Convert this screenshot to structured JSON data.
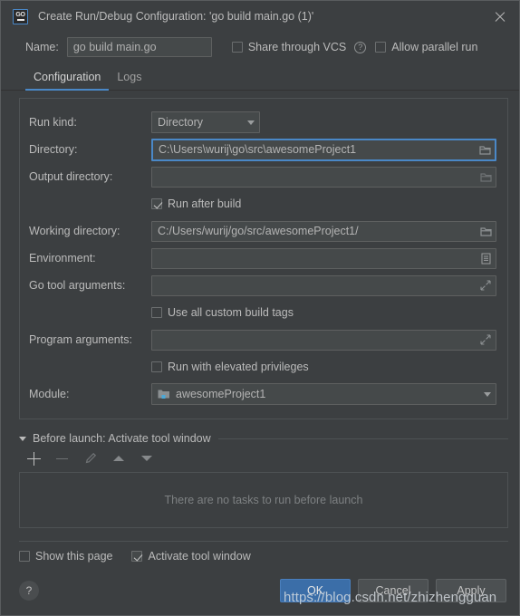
{
  "window": {
    "title": "Create Run/Debug Configuration: 'go build main.go (1)'",
    "app_icon": "go-icon",
    "close_icon": "close-icon"
  },
  "name_row": {
    "label": "Name:",
    "value": "go build main.go",
    "placeholder": "",
    "share_vcs_label": "Share through VCS",
    "share_vcs_checked": false,
    "help_icon": "help-icon",
    "allow_parallel_label": "Allow parallel run",
    "allow_parallel_checked": false
  },
  "tabs": [
    {
      "label": "Configuration",
      "active": true
    },
    {
      "label": "Logs",
      "active": false
    }
  ],
  "form": {
    "run_kind": {
      "label": "Run kind:",
      "value": "Directory"
    },
    "directory": {
      "label": "Directory:",
      "value": "C:\\Users\\wurij\\go\\src\\awesomeProject1",
      "icon": "folder-icon",
      "focused": true
    },
    "output_directory": {
      "label": "Output directory:",
      "value": "",
      "icon": "folder-icon"
    },
    "run_after_build": {
      "label": "Run after build",
      "checked": true
    },
    "working_directory": {
      "label": "Working directory:",
      "value": "C:/Users/wurij/go/src/awesomeProject1/",
      "icon": "folder-icon"
    },
    "environment": {
      "label": "Environment:",
      "value": "",
      "icon": "list-icon"
    },
    "go_tool_arguments": {
      "label": "Go tool arguments:",
      "value": "",
      "icon": "expand-icon"
    },
    "use_custom_build_tags": {
      "label": "Use all custom build tags",
      "checked": false
    },
    "program_arguments": {
      "label": "Program arguments:",
      "value": "",
      "icon": "expand-icon"
    },
    "run_elevated": {
      "label": "Run with elevated privileges",
      "checked": false
    },
    "module": {
      "label": "Module:",
      "value": "awesomeProject1",
      "icon": "module-folder-icon"
    }
  },
  "before_launch": {
    "title": "Before launch: Activate tool window",
    "expanded": true,
    "toolbar": [
      {
        "name": "add-button",
        "icon": "plus-icon",
        "enabled": true
      },
      {
        "name": "remove-button",
        "icon": "minus-icon",
        "enabled": false
      },
      {
        "name": "edit-button",
        "icon": "pencil-icon",
        "enabled": false
      },
      {
        "name": "move-up-button",
        "icon": "arrow-up-icon",
        "enabled": true
      },
      {
        "name": "move-down-button",
        "icon": "arrow-down-icon",
        "enabled": true
      }
    ],
    "empty_text": "There are no tasks to run before launch"
  },
  "footer": {
    "show_this_page": {
      "label": "Show this page",
      "checked": false
    },
    "activate_tool_window": {
      "label": "Activate tool window",
      "checked": true
    },
    "help_label": "?",
    "buttons": [
      {
        "label": "OK",
        "primary": true
      },
      {
        "label": "Cancel",
        "primary": false
      },
      {
        "label": "Apply",
        "primary": false
      }
    ]
  },
  "watermark": {
    "text": "https://blog.csdn.net/zhizhengguan"
  },
  "colors": {
    "background": "#3c3f41",
    "field": "#45494a",
    "accent": "#4a88c7",
    "text": "#bbbbbb",
    "primary_button": "#3b6ea8"
  }
}
